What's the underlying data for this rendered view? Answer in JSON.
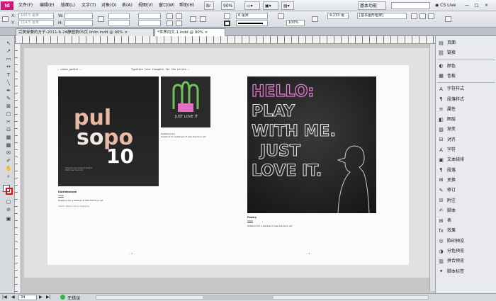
{
  "menubar": {
    "logo": "Id",
    "items": [
      "文件(F)",
      "编辑(E)",
      "版面(L)",
      "文字(T)",
      "对象(O)",
      "表(A)",
      "视图(V)",
      "窗口(W)",
      "帮助(H)"
    ],
    "zoom": "90%",
    "workspace": "基本功能",
    "cs_live": "CS Live",
    "search_placeholder": "",
    "window_buttons": [
      "—",
      "□",
      "×"
    ]
  },
  "controlbar": {
    "x_label": "X:",
    "y_label": "Y:",
    "x_value": "100.5 毫米",
    "y_value": "114.5 毫米",
    "w_label": "W:",
    "h_label": "H:",
    "stroke_weight": "0 毫米",
    "scale_pct": "100%",
    "angle": "4.233 毫",
    "style": "[基本图形框架]"
  },
  "tabs": [
    {
      "label": "完美穿要的方子-2011-6-24静图第05页 linlin.indd @ 90%",
      "active": false,
      "close": "×"
    },
    {
      "label": "*世界内文.1.indd @ 90%",
      "active": true,
      "close": "×"
    }
  ],
  "statusbar": {
    "page": "34",
    "status": "无错误"
  },
  "document": {
    "left_header_left": "— video_gather —",
    "left_header_right": "Typeface love thoughts for the prints —",
    "art_main_text": "paul\nsopo\n10",
    "small_art_caption": "JUST LOVE IT",
    "caption_title": "Kaleidoscope",
    "caption_year": "2009",
    "caption_body": "Graphics for a festival of new trends in art",
    "caption_meta": "Client: Rabinovitz & Designer",
    "right_caption_title": "Poetry",
    "right_caption_year": "2009",
    "right_caption_body": "Graphics for a festival of new trends in art",
    "right_art_lines": [
      "HELLO:",
      "PLAY",
      "WITH ME.",
      "JUST",
      "LOVE IT."
    ],
    "folio_left": "— 4 —",
    "folio_right": "— 5 —"
  },
  "panel": {
    "items": [
      {
        "icon": "pages-icon",
        "glyph": "▤",
        "label": "页面"
      },
      {
        "icon": "links-icon",
        "glyph": "⛓",
        "label": "链接"
      },
      {
        "icon": "color-icon",
        "glyph": "◐",
        "label": "颜色"
      },
      {
        "icon": "swatches-icon",
        "glyph": "▦",
        "label": "色板"
      },
      {
        "icon": "char-style-icon",
        "glyph": "A",
        "label": "字符样式"
      },
      {
        "icon": "para-style-icon",
        "glyph": "¶",
        "label": "段落样式"
      },
      {
        "icon": "attributes-icon",
        "glyph": "≡",
        "label": "属性"
      },
      {
        "icon": "layers-icon",
        "glyph": "◧",
        "label": "图层"
      },
      {
        "icon": "gradient-icon",
        "glyph": "▨",
        "label": "渐变"
      },
      {
        "icon": "align-icon",
        "glyph": "⊟",
        "label": "对齐"
      },
      {
        "icon": "character-icon",
        "glyph": "A",
        "label": "字符"
      },
      {
        "icon": "text-wrap-icon",
        "glyph": "▣",
        "label": "文本绕排"
      },
      {
        "icon": "paragraph-icon",
        "glyph": "¶",
        "label": "段落"
      },
      {
        "icon": "transform-icon",
        "glyph": "⊞",
        "label": "变换"
      },
      {
        "icon": "tracking-icon",
        "glyph": "✎",
        "label": "修订"
      },
      {
        "icon": "note-icon",
        "glyph": "✉",
        "label": "附注"
      },
      {
        "icon": "script-icon",
        "glyph": "✍",
        "label": "脚本"
      },
      {
        "icon": "table-icon",
        "glyph": "⊞",
        "label": "表"
      },
      {
        "icon": "effects-icon",
        "glyph": "fx",
        "label": "效果"
      },
      {
        "icon": "preflight-icon",
        "glyph": "◎",
        "label": "陷印预设"
      },
      {
        "icon": "separations-icon",
        "glyph": "◑",
        "label": "分色预览"
      },
      {
        "icon": "flattener-icon",
        "glyph": "▥",
        "label": "拼合预览"
      },
      {
        "icon": "script-label-icon",
        "glyph": "✦",
        "label": "脚本标签"
      }
    ]
  }
}
